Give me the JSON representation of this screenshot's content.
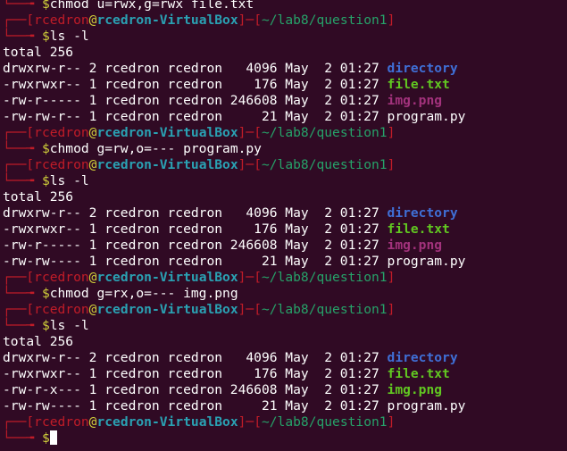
{
  "terminal": {
    "colors": {
      "background": "#300a24",
      "prompt_bracket": "#c01c28",
      "user": "#c01c28",
      "host": "#2aa1b3",
      "at": "#d0cf3a",
      "path": "#26a269",
      "directory": "#3f6fd6",
      "executable": "#61c721",
      "image": "#a2327c"
    },
    "prompt": {
      "top_prefix": "┌──[",
      "user": "rcedron",
      "at": "@",
      "host": "rcedron-VirtualBox",
      "path_open": "]─[",
      "path": "~/lab8/question1",
      "path_close": "]",
      "bottom_prefix": "└──╼ ",
      "dollar": "$"
    },
    "blocks": [
      {
        "command": "chmod u=rwx,g=rwx file.txt",
        "first_line_only_bottom": true
      },
      {
        "command": "ls -l",
        "total": "total 256",
        "rows": [
          {
            "meta": "drwxrw-r-- 2 rcedron rcedron   4096 May  2 01:27 ",
            "name": "directory",
            "kind": "dir"
          },
          {
            "meta": "-rwxrwxr-- 1 rcedron rcedron    176 May  2 01:27 ",
            "name": "file.txt",
            "kind": "exec"
          },
          {
            "meta": "-rw-r----- 1 rcedron rcedron 246608 May  2 01:27 ",
            "name": "img.png",
            "kind": "img"
          },
          {
            "meta": "-rw-rw-r-- 1 rcedron rcedron     21 May  2 01:27 ",
            "name": "program.py",
            "kind": "plain"
          }
        ]
      },
      {
        "command": "chmod g=rw,o=--- program.py"
      },
      {
        "command": "ls -l",
        "total": "total 256",
        "rows": [
          {
            "meta": "drwxrw-r-- 2 rcedron rcedron   4096 May  2 01:27 ",
            "name": "directory",
            "kind": "dir"
          },
          {
            "meta": "-rwxrwxr-- 1 rcedron rcedron    176 May  2 01:27 ",
            "name": "file.txt",
            "kind": "exec"
          },
          {
            "meta": "-rw-r----- 1 rcedron rcedron 246608 May  2 01:27 ",
            "name": "img.png",
            "kind": "img"
          },
          {
            "meta": "-rw-rw---- 1 rcedron rcedron     21 May  2 01:27 ",
            "name": "program.py",
            "kind": "plain"
          }
        ]
      },
      {
        "command": "chmod g=rx,o=--- img.png"
      },
      {
        "command": "ls -l",
        "total": "total 256",
        "rows": [
          {
            "meta": "drwxrw-r-- 2 rcedron rcedron   4096 May  2 01:27 ",
            "name": "directory",
            "kind": "dir"
          },
          {
            "meta": "-rwxrwxr-- 1 rcedron rcedron    176 May  2 01:27 ",
            "name": "file.txt",
            "kind": "exec"
          },
          {
            "meta": "-rw-r-x--- 1 rcedron rcedron 246608 May  2 01:27 ",
            "name": "img.png",
            "kind": "exec"
          },
          {
            "meta": "-rw-rw---- 1 rcedron rcedron     21 May  2 01:27 ",
            "name": "program.py",
            "kind": "plain"
          }
        ]
      },
      {
        "command": "",
        "active": true
      }
    ]
  }
}
